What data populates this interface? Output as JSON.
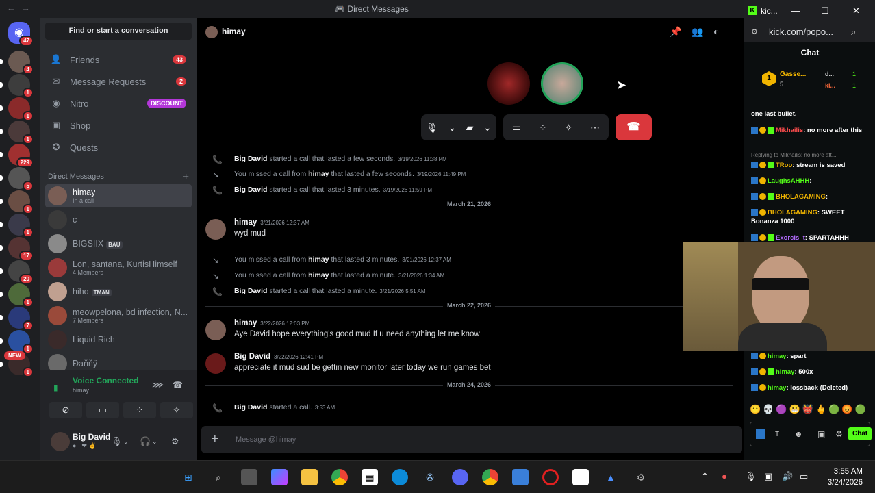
{
  "window": {
    "title": "Direct Messages",
    "back": "←",
    "forward": "→"
  },
  "rail": {
    "home_badge": "47",
    "servers": [
      {
        "badge": "4",
        "color": "#6b5a52"
      },
      {
        "badge": "1",
        "color": "#3d3d3d"
      },
      {
        "badge": "1",
        "color": "#8a2a2a"
      },
      {
        "badge": "1",
        "color": "#4b3a3a"
      },
      {
        "badge": "229",
        "color": "#a03030"
      },
      {
        "badge": "5",
        "color": "#555"
      },
      {
        "badge": "1",
        "color": "#6a4e44"
      },
      {
        "badge": "1",
        "color": "#3a3a4a"
      },
      {
        "badge": "17",
        "color": "#553333"
      },
      {
        "badge": "20",
        "color": "#444"
      },
      {
        "badge": "1",
        "color": "#4e6a3a"
      },
      {
        "badge": "7",
        "color": "#2a3a7a"
      },
      {
        "badge": "1",
        "color": "#2a50a0"
      },
      {
        "badge": "1",
        "color": "#3a2a2a"
      }
    ],
    "new_label": "NEW"
  },
  "sidebar": {
    "find": "Find or start a conversation",
    "nav": [
      {
        "label": "Friends",
        "count": "43",
        "icon": "friends-icon",
        "glyph": "👤"
      },
      {
        "label": "Message Requests",
        "count": "2",
        "icon": "mail-icon",
        "glyph": "✉"
      },
      {
        "label": "Nitro",
        "promo": "DISCOUNT",
        "icon": "nitro-icon",
        "glyph": "◉"
      },
      {
        "label": "Shop",
        "icon": "shop-icon",
        "glyph": "▣"
      },
      {
        "label": "Quests",
        "icon": "quests-icon",
        "glyph": "✪"
      }
    ],
    "dm_header": "Direct Messages",
    "dm_add": "+",
    "dms": [
      {
        "name": "himay",
        "sub": "In a call",
        "selected": true
      },
      {
        "name": "c",
        "sub": ""
      },
      {
        "name": "BIGSIIX",
        "tag": "BAU",
        "sub": ""
      },
      {
        "name": "Lon, santana, KurtisHimself",
        "sub": "4 Members"
      },
      {
        "name": "hiho",
        "tag": "TMAN",
        "sub": ""
      },
      {
        "name": "meowpelona, bd infection, N...",
        "sub": "7 Members"
      },
      {
        "name": "Liquid Rich",
        "sub": ""
      },
      {
        "name": "Đaňňÿ",
        "sub": ""
      }
    ]
  },
  "voice": {
    "status": "Voice Connected",
    "channel": "himay"
  },
  "user": {
    "name": "Big David",
    "status": "● · ❤ ✌"
  },
  "channel": {
    "name": "himay"
  },
  "messages": [
    {
      "kind": "sys",
      "icon": "out",
      "actor": "Big David",
      "text": "started a call that lasted a few seconds.",
      "ts": "3/19/2026 11:38 PM"
    },
    {
      "kind": "sys",
      "icon": "missed",
      "pre": "You missed a call from",
      "actor": "himay",
      "text": "that lasted a few seconds.",
      "ts": "3/19/2026 11:49 PM"
    },
    {
      "kind": "sys",
      "icon": "out",
      "actor": "Big David",
      "text": "started a call that lasted 3 minutes.",
      "ts": "3/19/2026 11:59 PM"
    },
    {
      "kind": "div",
      "text": "March 21, 2026"
    },
    {
      "kind": "msg",
      "author": "himay",
      "ts": "3/21/2026 12:37 AM",
      "text": "wyd mud"
    },
    {
      "kind": "sys",
      "icon": "missed",
      "pre": "You missed a call from",
      "actor": "himay",
      "text": "that lasted 3 minutes.",
      "ts": "3/21/2026 12:37 AM"
    },
    {
      "kind": "sys",
      "icon": "missed",
      "pre": "You missed a call from",
      "actor": "himay",
      "text": "that lasted a minute.",
      "ts": "3/21/2026 1:34 AM"
    },
    {
      "kind": "sys",
      "icon": "out",
      "actor": "Big David",
      "text": "started a call that lasted a minute.",
      "ts": "3/21/2026 5:51 AM"
    },
    {
      "kind": "div",
      "text": "March 22, 2026"
    },
    {
      "kind": "msg",
      "author": "himay",
      "ts": "3/22/2026 12:03 PM",
      "text": "Aye David hope everything's good mud If u need anything let me know"
    },
    {
      "kind": "msg",
      "author": "Big David",
      "ts": "3/22/2026 12:41 PM",
      "text": "appreciate it mud sud be gettin new monitor later today we run games bet"
    },
    {
      "kind": "div",
      "text": "March 24, 2026"
    },
    {
      "kind": "sys",
      "icon": "out",
      "actor": "Big David",
      "text": "started a call.",
      "ts": "3:53 AM"
    }
  ],
  "composer": {
    "placeholder": "Message @himay"
  },
  "kick": {
    "tab_title": "kic...",
    "url": "kick.com/popo...",
    "chat_title": "Chat",
    "leader": {
      "name": "Gasse...",
      "count": "5",
      "d": "d...",
      "d_count": "1",
      "ki": "ki...",
      "ki_count": "1"
    },
    "lines": [
      {
        "user": "",
        "text": "one last bullet."
      },
      {
        "user": "Mikhailis",
        "text": ": no more after this",
        "color": "#ff4d4d"
      },
      {
        "reply": "Replying to Mikhailis: no more aft..."
      },
      {
        "user": "TRoo",
        "text": ": stream is saved",
        "color": "#f0b400"
      },
      {
        "user": "LaughsAHHH",
        "text": ":",
        "color": "#53fc18"
      },
      {
        "user": "BHOLAGAMING",
        "text": ":",
        "color": "#f0b400"
      },
      {
        "user": "BHOLAGAMING",
        "text": ": SWEET Bonanza 1000",
        "color": "#f0b400"
      },
      {
        "user": "Exorcis_t",
        "text": ": SPARTAHHH",
        "color": "#b46cff"
      },
      {
        "user": "himay",
        "text": ": spart",
        "color": "#53fc18"
      },
      {
        "user": "himay",
        "text": ": 500x",
        "color": "#53fc18"
      },
      {
        "user": "himay",
        "text": ": lossback (Deleted)",
        "color": "#53fc18"
      }
    ],
    "send": "Chat"
  },
  "taskbar": {
    "time": "3:55 AM",
    "date": "3/24/2026"
  }
}
